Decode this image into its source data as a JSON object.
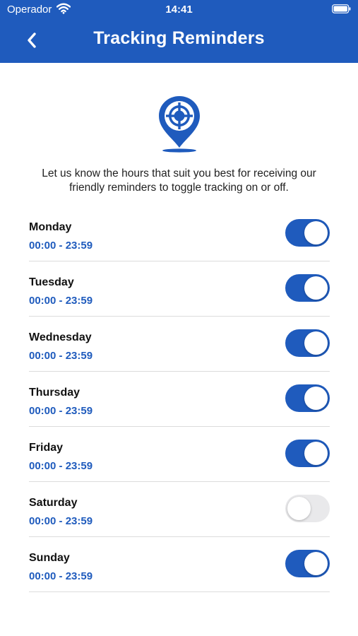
{
  "status_bar": {
    "carrier": "Operador",
    "time": "14:41"
  },
  "header": {
    "title": "Tracking Reminders"
  },
  "intro": "Let us know the hours that suit you best for receiving our friendly reminders to toggle tracking on or off.",
  "colors": {
    "accent": "#1f5bbd",
    "toggle_off": "#e9e9eb"
  },
  "days": [
    {
      "name": "Monday",
      "hours": "00:00 - 23:59",
      "enabled": true
    },
    {
      "name": "Tuesday",
      "hours": "00:00 - 23:59",
      "enabled": true
    },
    {
      "name": "Wednesday",
      "hours": "00:00 - 23:59",
      "enabled": true
    },
    {
      "name": "Thursday",
      "hours": "00:00 - 23:59",
      "enabled": true
    },
    {
      "name": "Friday",
      "hours": "00:00 - 23:59",
      "enabled": true
    },
    {
      "name": "Saturday",
      "hours": "00:00 - 23:59",
      "enabled": false
    },
    {
      "name": "Sunday",
      "hours": "00:00 - 23:59",
      "enabled": true
    }
  ]
}
